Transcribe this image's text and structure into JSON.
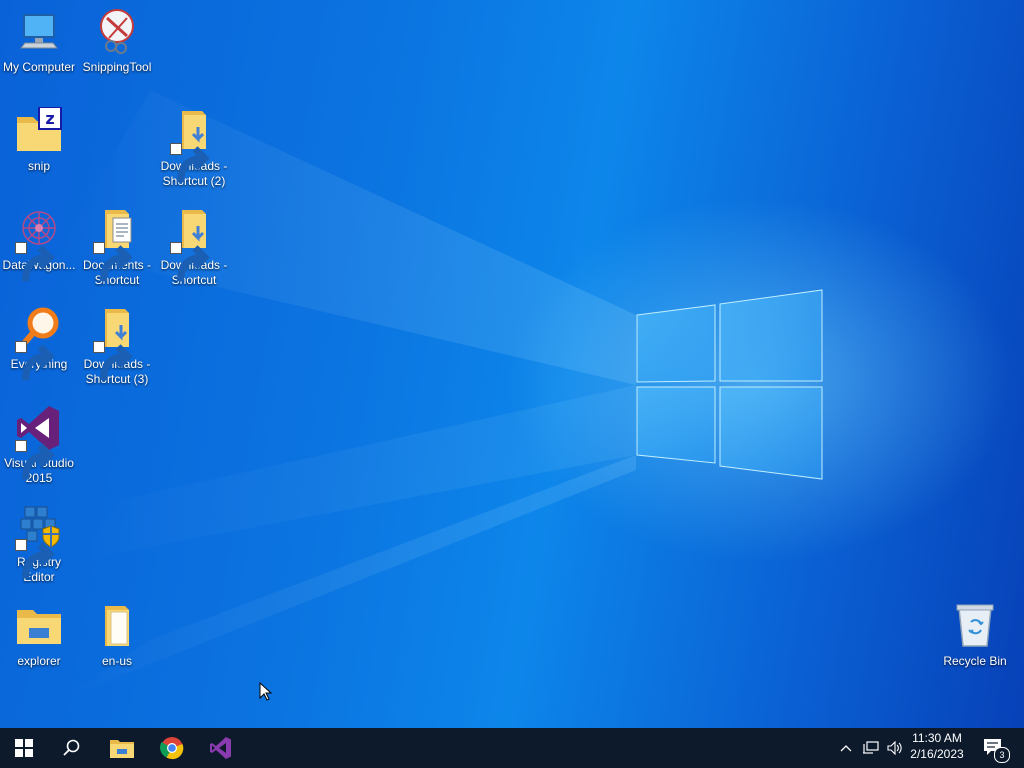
{
  "desktop": {
    "icons": {
      "my_computer": {
        "label": "My Computer",
        "icon": "computer-icon"
      },
      "snipping_tool": {
        "label": "SnippingTool",
        "icon": "scissors-icon"
      },
      "snip": {
        "label": "snip",
        "icon": "folder-icon"
      },
      "downloads_2": {
        "label": "Downloads - Shortcut (2)",
        "icon": "downloads-folder-icon"
      },
      "datawagon": {
        "label": "DataWagon...",
        "icon": "datawagon-icon"
      },
      "documents": {
        "label": "Documents - Shortcut",
        "icon": "documents-folder-icon"
      },
      "downloads": {
        "label": "Downloads - Shortcut",
        "icon": "downloads-folder-icon"
      },
      "everything": {
        "label": "Everything",
        "icon": "magnifier-icon"
      },
      "downloads_3": {
        "label": "Downloads - Shortcut (3)",
        "icon": "downloads-folder-icon"
      },
      "visual_studio": {
        "label": "Visual Studio 2015",
        "icon": "visual-studio-icon"
      },
      "registry_editor": {
        "label": "Registry Editor",
        "icon": "registry-icon"
      },
      "explorer": {
        "label": "explorer",
        "icon": "file-explorer-icon"
      },
      "en_us": {
        "label": "en-us",
        "icon": "folder-icon"
      },
      "recycle_bin": {
        "label": "Recycle Bin",
        "icon": "recycle-bin-icon"
      }
    }
  },
  "taskbar": {
    "pinned": [
      "start-icon",
      "search-icon",
      "file-explorer-icon",
      "chrome-icon",
      "visual-studio-icon"
    ],
    "tray": {
      "time": "11:30 AM",
      "date": "2/16/2023",
      "notification_count": "3"
    }
  },
  "colors": {
    "taskbar": "#0c1a2c",
    "wallpaper": "#0a62d8",
    "vs_purple": "#68217a",
    "folder_yellow": "#f8d775"
  }
}
